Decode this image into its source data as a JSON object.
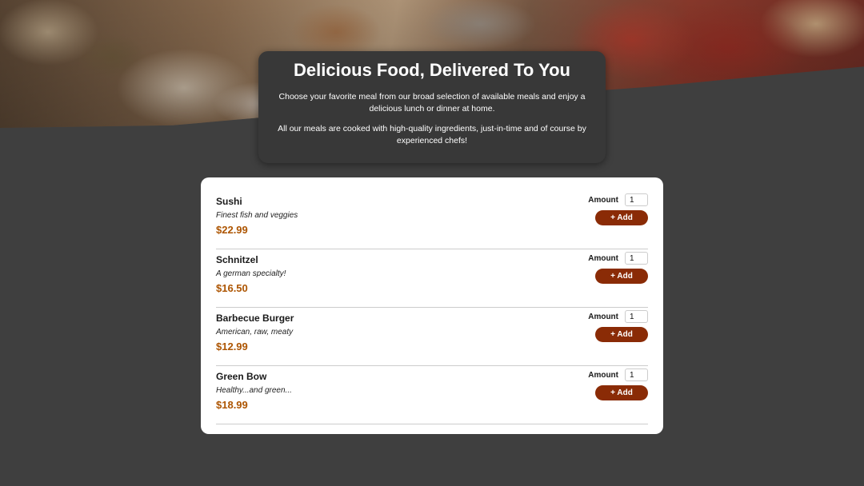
{
  "summary": {
    "title": "Delicious Food, Delivered To You",
    "paragraph_1": "Choose your favorite meal from our broad selection of available meals and enjoy a delicious lunch or dinner at home.",
    "paragraph_2": "All our meals are cooked with high-quality ingredients, just-in-time and of course by experienced chefs!"
  },
  "meals": [
    {
      "name": "Sushi",
      "description": "Finest fish and veggies",
      "price": "$22.99",
      "amount_label": "Amount",
      "amount_value": "1",
      "add_label": "+ Add"
    },
    {
      "name": "Schnitzel",
      "description": "A german specialty!",
      "price": "$16.50",
      "amount_label": "Amount",
      "amount_value": "1",
      "add_label": "+ Add"
    },
    {
      "name": "Barbecue Burger",
      "description": "American, raw, meaty",
      "price": "$12.99",
      "amount_label": "Amount",
      "amount_value": "1",
      "add_label": "+ Add"
    },
    {
      "name": "Green Bow",
      "description": "Healthy...and green...",
      "price": "$18.99",
      "amount_label": "Amount",
      "amount_value": "1",
      "add_label": "+ Add"
    }
  ],
  "colors": {
    "background": "#3f3f3f",
    "summary_card": "#383838",
    "price": "#ad5502",
    "button": "#8a2b06"
  }
}
